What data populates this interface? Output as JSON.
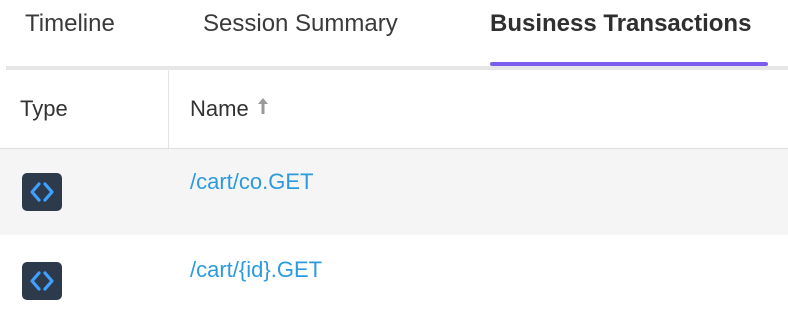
{
  "tabs": [
    {
      "label": "Timeline",
      "active": false
    },
    {
      "label": "Session Summary",
      "active": false
    },
    {
      "label": "Business Transactions",
      "active": true
    }
  ],
  "colors": {
    "active_tab_underline": "#7b5cf0",
    "link": "#2b9be0",
    "icon_bg": "#2d3a4c",
    "icon_glyph": "#3fa0ff",
    "row_alt_bg": "#f5f5f5"
  },
  "table": {
    "columns": [
      {
        "label": "Type"
      },
      {
        "label": "Name",
        "sort": "ascending",
        "sort_icon": "arrow-up-icon"
      }
    ],
    "rows": [
      {
        "type_icon": "code-brackets-icon",
        "name": "/cart/co.GET"
      },
      {
        "type_icon": "code-brackets-icon",
        "name": "/cart/{id}.GET"
      }
    ]
  }
}
